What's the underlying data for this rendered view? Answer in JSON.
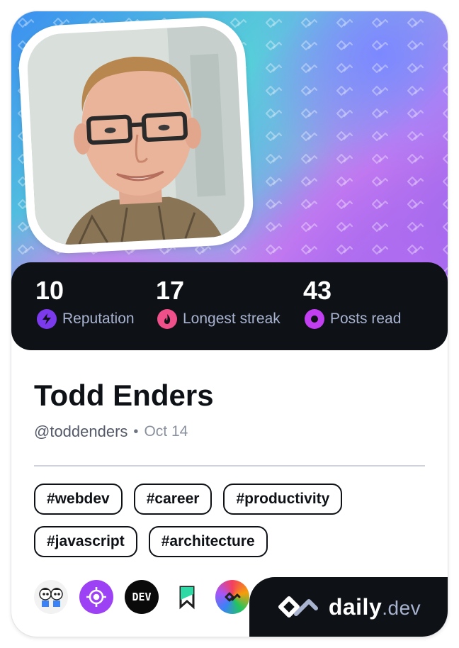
{
  "profile": {
    "name": "Todd Enders",
    "handle": "@toddenders",
    "separator": "•",
    "date": "Oct 14"
  },
  "stats": [
    {
      "value": "10",
      "label": "Reputation",
      "icon": "lightning-icon",
      "color": "#7c3aed"
    },
    {
      "value": "17",
      "label": "Longest streak",
      "icon": "flame-icon",
      "color": "#f0508a"
    },
    {
      "value": "43",
      "label": "Posts read",
      "icon": "eye-ring-icon",
      "color": "#c13ff0"
    }
  ],
  "tags": [
    [
      "#webdev",
      "#career",
      "#productivity"
    ],
    [
      "#javascript",
      "#architecture"
    ]
  ],
  "sources": [
    {
      "icon": "cartoon-duo-icon"
    },
    {
      "icon": "target-icon",
      "color": "#9d41f4"
    },
    {
      "icon": "dev-icon",
      "text": "DEV"
    },
    {
      "icon": "bookmark-logo-icon"
    },
    {
      "icon": "gradient-source-icon"
    }
  ],
  "brand": {
    "name": "daily",
    "suffix": ".dev"
  },
  "colors": {
    "dark": "#0e1217",
    "muted": "#a8b3cf"
  }
}
